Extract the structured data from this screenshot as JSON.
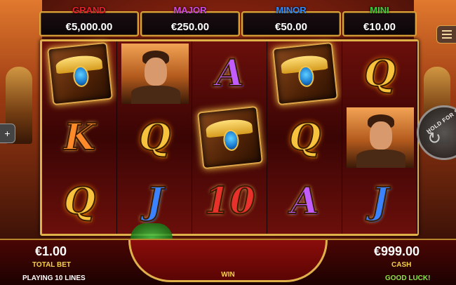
{
  "jackpots": [
    {
      "label": "GRAND",
      "value": "€5,000.00",
      "color": "#e8202a"
    },
    {
      "label": "MAJOR",
      "value": "€250.00",
      "color": "#d24be0"
    },
    {
      "label": "MINOR",
      "value": "€50.00",
      "color": "#2f8cff"
    },
    {
      "label": "MINI",
      "value": "€10.00",
      "color": "#3fcf3f"
    }
  ],
  "reels": [
    [
      {
        "symbol": "book"
      },
      {
        "symbol": "K",
        "color": "orange"
      },
      {
        "symbol": "Q",
        "color": "gold"
      }
    ],
    [
      {
        "symbol": "explorer"
      },
      {
        "symbol": "Q",
        "color": "gold"
      },
      {
        "symbol": "J",
        "color": "blue"
      }
    ],
    [
      {
        "symbol": "A",
        "color": "purple"
      },
      {
        "symbol": "book"
      },
      {
        "symbol": "10",
        "color": "red"
      }
    ],
    [
      {
        "symbol": "book"
      },
      {
        "symbol": "Q",
        "color": "gold"
      },
      {
        "symbol": "A",
        "color": "purple"
      }
    ],
    [
      {
        "symbol": "Q",
        "color": "gold"
      },
      {
        "symbol": "explorer"
      },
      {
        "symbol": "J",
        "color": "blue"
      }
    ]
  ],
  "controls": {
    "menu_icon": "hamburger-icon",
    "hold_for_settings": "HOLD FOR SET",
    "left_tab": "+"
  },
  "footer": {
    "total_bet_value": "€1.00",
    "total_bet_label": "TOTAL BET",
    "lines": "PLAYING 10 LINES",
    "win_label": "WIN",
    "cash_value": "€999.00",
    "cash_label": "CASH",
    "good_luck": "GOOD LUCK!"
  }
}
